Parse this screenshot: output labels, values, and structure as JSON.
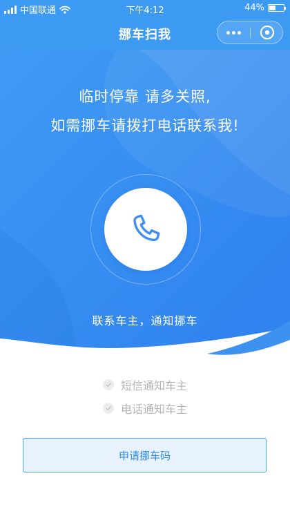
{
  "status_bar": {
    "carrier": "中国联通",
    "time": "下午4:12",
    "battery": "44%",
    "battery_level": 0.44
  },
  "nav": {
    "title": "挪车扫我",
    "more_icon": "more-dots-icon",
    "close_icon": "close-circle-icon"
  },
  "hero": {
    "line1": "临时停靠 请多关照,",
    "line2": "如需挪车请拨打电话联系我!",
    "call_icon": "phone-icon",
    "caption": "联系车主，通知挪车"
  },
  "options": [
    {
      "label": "短信通知车主",
      "icon": "check-icon"
    },
    {
      "label": "电话通知车主",
      "icon": "check-icon"
    }
  ],
  "apply_button": {
    "label": "申请挪车码"
  },
  "colors": {
    "primary_blue": "#3d9af3",
    "dark_blue": "#2f86ee",
    "button_text": "#2e8ae6",
    "button_bg": "#e7f2fd",
    "muted_text": "#b3b3b3"
  }
}
